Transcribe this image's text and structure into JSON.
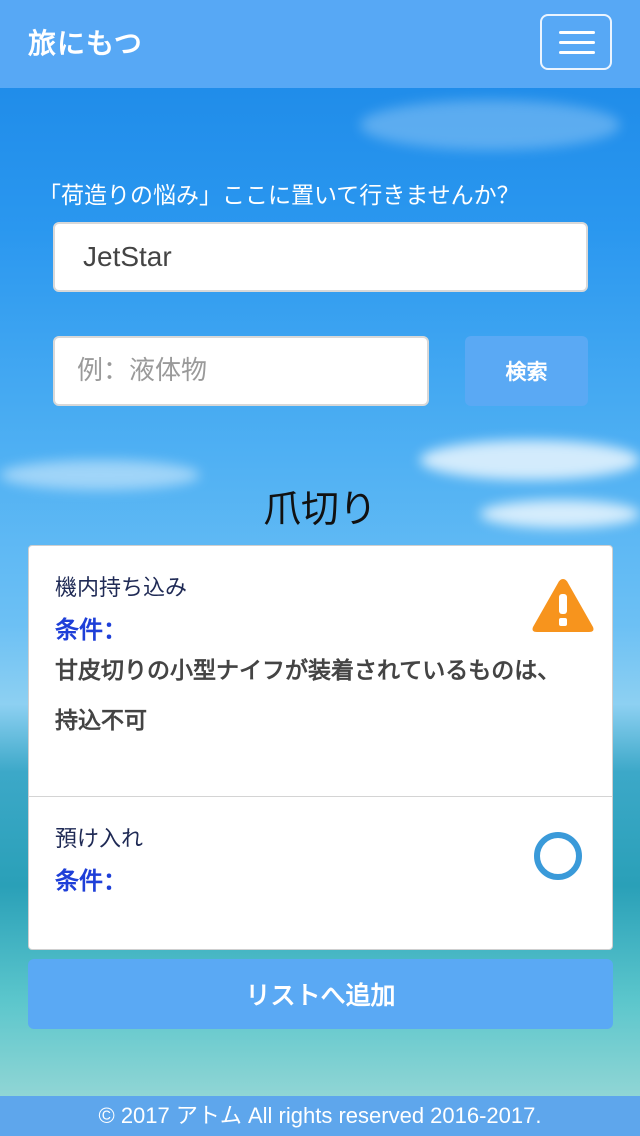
{
  "header": {
    "brand": "旅にもつ",
    "menu_icon": "hamburger-menu-icon"
  },
  "search": {
    "tagline": "「荷造りの悩み」ここに置いて行きませんか？",
    "airline_value": "JetStar",
    "item_placeholder": "例：液体物",
    "search_label": "検索"
  },
  "result": {
    "item_name": "爪切り",
    "carry_on": {
      "label": "機内持ち込み",
      "condition_label": "条件：",
      "condition_text": "甘皮切りの小型ナイフが装着されているものは、持込不可",
      "status_icon": "warning-icon",
      "status_color": "#f7941d"
    },
    "checked": {
      "label": "預け入れ",
      "condition_label": "条件：",
      "condition_text": "",
      "status_icon": "circle-ok-icon",
      "status_color": "#3a9ad9"
    }
  },
  "actions": {
    "add_to_list_label": "リストへ追加"
  },
  "footer": {
    "copyright": "© 2017 アトム All rights reserved 2016-2017."
  },
  "colors": {
    "navbar": "#57a8f5",
    "button": "#5aa9f4",
    "condition_label": "#1e3fd8"
  }
}
